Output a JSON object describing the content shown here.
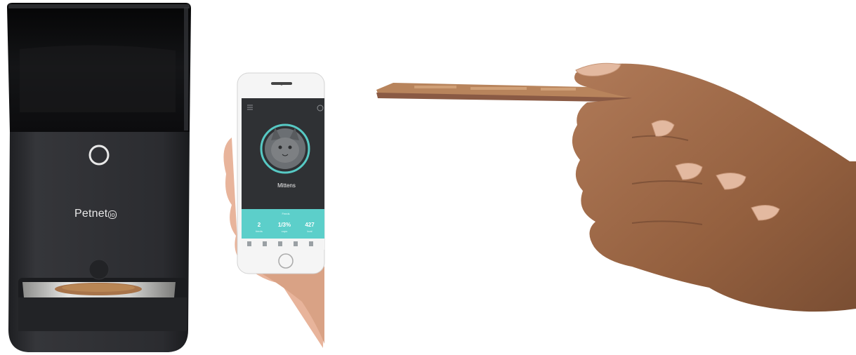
{
  "feeder": {
    "brand": "Petnet",
    "brand_mark": "io",
    "colors": {
      "body": "#2d2e32",
      "hopper": "#111214",
      "bowl": "#c8c8c6",
      "kibble": "#a8744a"
    }
  },
  "phone_app": {
    "pet_name": "Mittens",
    "strip_title": "Feeds",
    "stats": [
      {
        "value": "2",
        "label": "feeds"
      },
      {
        "value": "1/3%",
        "label": "cups"
      },
      {
        "value": "427",
        "label": "kcal"
      }
    ],
    "colors": {
      "screen": "#2f3134",
      "accent": "#5ccfca",
      "ring": "#57c9c4"
    },
    "icons": [
      "menu-icon",
      "settings-icon",
      "home-icon",
      "pet-icon",
      "schedule-icon",
      "shop-icon",
      "profile-icon"
    ]
  },
  "card_hand": {
    "colors": {
      "skin": "#9a6748",
      "card_edge": "#8a5a44"
    }
  }
}
